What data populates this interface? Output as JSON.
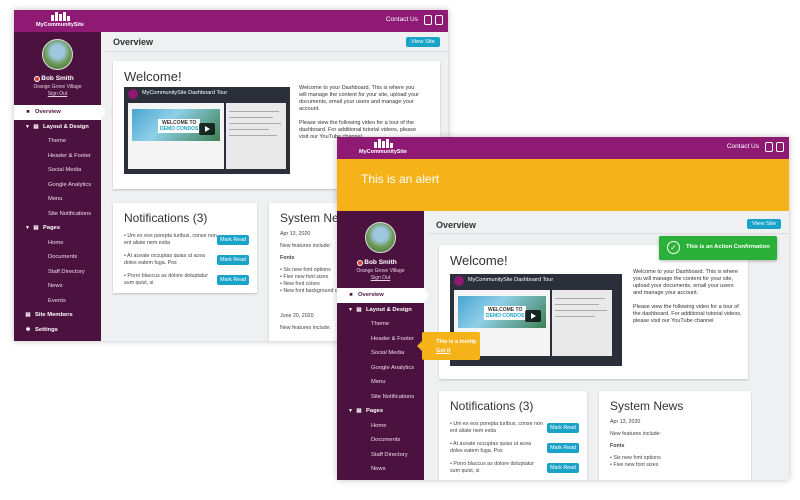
{
  "header": {
    "logo_text": "MyCommunitySite",
    "contact_label": "Contact Us",
    "mail_icon": "mail-icon",
    "phone_icon": "phone-icon"
  },
  "alert": {
    "text": "This is an alert"
  },
  "user": {
    "name": "Bob Smith",
    "org": "Orange Grove Village",
    "signout": "Sign Out"
  },
  "nav": {
    "overview": "Overview",
    "layout_design": "Layout & Design",
    "theme": "Theme",
    "header_footer": "Header & Footer",
    "social_media": "Social Media",
    "google_analytics": "Google Analytics",
    "menu": "Menu",
    "site_notifications": "Site Notifications",
    "pages": "Pages",
    "home": "Home",
    "documents": "Documents",
    "staff_directory": "Staff Directory",
    "news": "News",
    "events": "Events",
    "site_members": "Site Members",
    "settings": "Settings"
  },
  "page": {
    "title": "Overview",
    "view_site": "View Site"
  },
  "welcome": {
    "heading": "Welcome!",
    "video_title": "MyCommunitySite Dashboard Tour",
    "video_overlay_line1": "WELCOME TO",
    "video_overlay_line2": "DEMO CONDOS",
    "para1": "Welcome to your Dashboard. This is where you will manage the content for your site, upload your documents, email your users and manage your account.",
    "para2": "Please view the following video for a tour of the dashboard.  For additional tutorial videos, please visit our YouTube channel"
  },
  "notifications": {
    "heading": "Notifications (3)",
    "mark_read_label": "Mark Read",
    "items": [
      "Um ex eos porepta turibus, conse non ent aliate nem estia",
      "At aceate occuptas quias ut acea doles eatem fuga. Pos",
      "Porro blaccus as dolore doluptatur sum quist, si"
    ]
  },
  "system_news": {
    "heading": "System News",
    "date1": "Apr 13, 2020",
    "intro": "New features include:",
    "fonts_label": "Fonts",
    "features": [
      "Six new font options",
      "Five new font sizes",
      "New font colors",
      "New font background colors"
    ],
    "date2": "June 20, 2020",
    "intro2": "New features include:"
  },
  "tooltip": {
    "text": "This is a tooltip",
    "link": "Got it"
  },
  "toast": {
    "text": "This is an Action Confirmation"
  }
}
